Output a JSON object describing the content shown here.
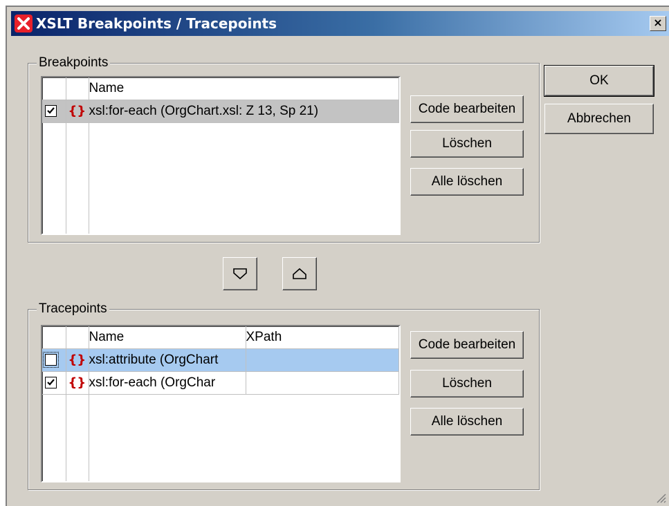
{
  "window": {
    "title": "XSLT Breakpoints / Tracepoints",
    "close_label": "×"
  },
  "breakpoints": {
    "group_label": "Breakpoints",
    "columns": [
      "",
      "",
      "Name"
    ],
    "rows": [
      {
        "checked": true,
        "name": "xsl:for-each  (OrgChart.xsl: Z 13, Sp 21)"
      }
    ],
    "buttons": {
      "edit": "Code bearbeiten",
      "delete": "Löschen",
      "delete_all": "Alle löschen"
    }
  },
  "tracepoints": {
    "group_label": "Tracepoints",
    "columns": [
      "",
      "",
      "Name",
      "XPath"
    ],
    "rows": [
      {
        "checked": false,
        "name": "xsl:attribute  (OrgChart",
        "xpath": ""
      },
      {
        "checked": true,
        "name": "xsl:for-each  (OrgChar",
        "xpath": ""
      }
    ],
    "buttons": {
      "edit": "Code bearbeiten",
      "delete": "Löschen",
      "delete_all": "Alle löschen"
    }
  },
  "dialog_buttons": {
    "ok": "OK",
    "cancel": "Abbrechen"
  },
  "icons": {
    "app": "altova-xmlspy-icon",
    "move_down": "triangle-down-icon",
    "move_up": "triangle-up-icon",
    "xsl_instruction": "braces-icon"
  },
  "colors": {
    "titlebar_start": "#0a246a",
    "titlebar_end": "#a6caf0",
    "selection": "#a6caf0",
    "brace": "#c00000"
  }
}
